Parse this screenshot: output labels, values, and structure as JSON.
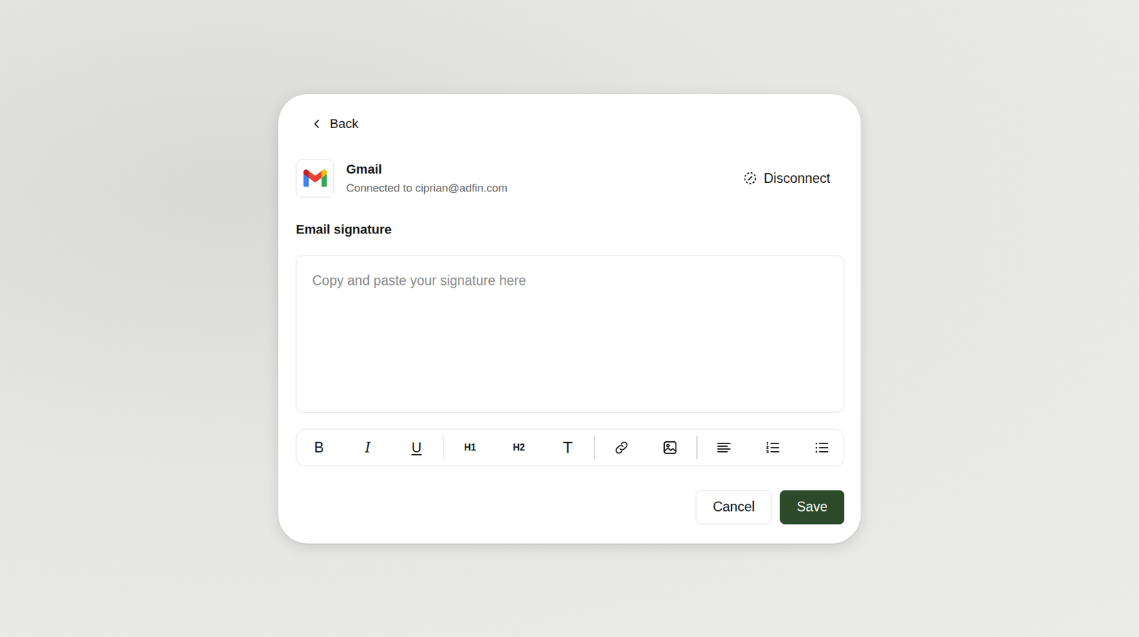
{
  "back": {
    "label": "Back"
  },
  "integration": {
    "name": "Gmail",
    "status": "Connected to ciprian@adfin.com",
    "action": "Disconnect"
  },
  "signature": {
    "title": "Email signature",
    "placeholder": "Copy and paste your signature here"
  },
  "toolbar": {
    "format": [
      "B",
      "I",
      "U"
    ],
    "headings": [
      "H1",
      "H2",
      "T"
    ]
  },
  "buttons": [
    {
      "label": "Cancel",
      "kind": "secondary"
    },
    {
      "label": "Save",
      "kind": "primary"
    }
  ]
}
